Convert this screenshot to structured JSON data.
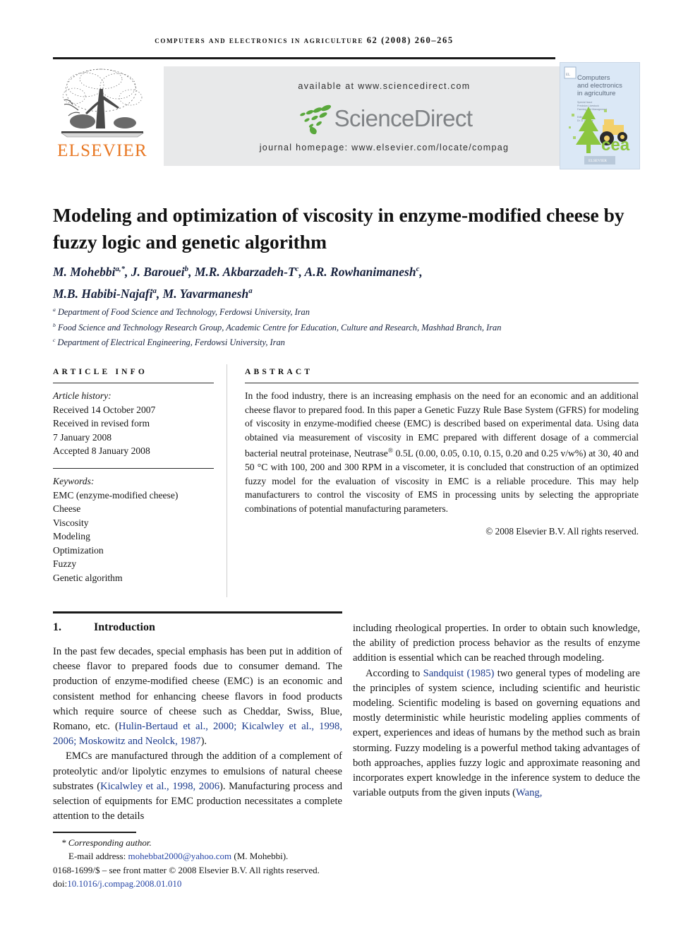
{
  "running_head": "COMPUTERS AND ELECTRONICS IN AGRICULTURE 62 (2008) 260–265",
  "masthead": {
    "publisher_name": "ELSEVIER",
    "publisher_logo_alt": "elsevier-tree-logo",
    "available_at": "available at www.sciencedirect.com",
    "sciencedirect_wordmark": "ScienceDirect",
    "journal_homepage": "journal homepage: www.elsevier.com/locate/compag",
    "cover": {
      "title_line1": "Computers",
      "title_line2": "and electronics",
      "title_line3": "in agriculture",
      "sub_line1": "Special Issue",
      "sub_line2": "Precision Livestock",
      "sub_line3": "Farming and Management",
      "editor_label": "Editor",
      "editor_name": "Dr. D. Goense",
      "acronym": "cea",
      "footer": "ELSEVIER"
    }
  },
  "article": {
    "title": "Modeling and optimization of viscosity in enzyme-modified cheese by fuzzy logic and genetic algorithm",
    "authors": [
      {
        "name": "M. Mohebbi",
        "sup": "a,*"
      },
      {
        "name": "J. Barouei",
        "sup": "b"
      },
      {
        "name": "M.R. Akbarzadeh-T",
        "sup": "c"
      },
      {
        "name": "A.R. Rowhanimanesh",
        "sup": "c"
      },
      {
        "name": "M.B. Habibi-Najafi",
        "sup": "a"
      },
      {
        "name": "M. Yavarmanesh",
        "sup": "a"
      }
    ],
    "affiliations": [
      {
        "label": "a",
        "text": "Department of Food Science and Technology, Ferdowsi University, Iran"
      },
      {
        "label": "b",
        "text": "Food Science and Technology Research Group, Academic Centre for Education, Culture and Research, Mashhad Branch, Iran"
      },
      {
        "label": "c",
        "text": "Department of Electrical Engineering, Ferdowsi University, Iran"
      }
    ]
  },
  "info": {
    "label": "ARTICLE INFO",
    "history_title": "Article history:",
    "history_lines": [
      "Received 14 October 2007",
      "Received in revised form",
      "7 January 2008",
      "Accepted 8 January 2008"
    ],
    "keywords_title": "Keywords:",
    "keywords": [
      "EMC (enzyme-modified cheese)",
      "Cheese",
      "Viscosity",
      "Modeling",
      "Optimization",
      "Fuzzy",
      "Genetic algorithm"
    ]
  },
  "abstract": {
    "label": "ABSTRACT",
    "text_part1": "In the food industry, there is an increasing emphasis on the need for an economic and an additional cheese flavor to prepared food. In this paper a Genetic Fuzzy Rule Base System (GFRS) for modeling of viscosity in enzyme-modified cheese (EMC) is described based on experimental data. Using data obtained via measurement of viscosity in EMC prepared with different dosage of a commercial bacterial neutral proteinase, Neutrase",
    "registered_mark": "®",
    "text_part2": " 0.5L (0.00, 0.05, 0.10, 0.15, 0.20 and 0.25 v/w%) at 30, 40 and 50 °C with 100, 200 and 300 RPM in a viscometer, it is concluded that construction of an optimized fuzzy model for the evaluation of viscosity in EMC is a reliable procedure. This may help manufacturers to control the viscosity of EMS in processing units by selecting the appropriate combinations of potential manufacturing parameters.",
    "copyright": "© 2008 Elsevier B.V. All rights reserved."
  },
  "introduction": {
    "number": "1.",
    "heading": "Introduction",
    "left_p1_a": "In the past few decades, special emphasis has been put in addition of cheese flavor to prepared foods due to consumer demand. The production of enzyme-modified cheese (EMC) is an economic and consistent method for enhancing cheese flavors in food products which require source of cheese such as Cheddar, Swiss, Blue, Romano, etc. (",
    "left_p1_ref": "Hulin-Bertaud et al., 2000; Kicalwley et al., 1998, 2006; Moskowitz and Neolck, 1987",
    "left_p1_b": ").",
    "left_p2_a": "EMCs are manufactured through the addition of a complement of proteolytic and/or lipolytic enzymes to emulsions of natural cheese substrates (",
    "left_p2_ref": "Kicalwley et al., 1998, 2006",
    "left_p2_b": "). Manufacturing process and selection of equipments for EMC production necessitates a complete attention to the details",
    "right_p1": "including rheological properties. In order to obtain such knowledge, the ability of prediction process behavior as the results of enzyme addition is essential which can be reached through modeling.",
    "right_p2_a": "According to ",
    "right_p2_ref": "Sandquist (1985)",
    "right_p2_b": " two general types of modeling are the principles of system science, including scientific and heuristic modeling. Scientific modeling is based on governing equations and mostly deterministic while heuristic modeling applies comments of expert, experiences and ideas of humans by the method such as brain storming. Fuzzy modeling is a powerful method taking advantages of both approaches, applies fuzzy logic and approximate reasoning and incorporates expert knowledge in the inference system to deduce the variable outputs from the given inputs (",
    "right_p2_ref2": "Wang,"
  },
  "footnote": {
    "corresponding": "* Corresponding author.",
    "email_label": "E-mail address: ",
    "email": "mohebbat2000@yahoo.com",
    "email_suffix": " (M. Mohebbi).",
    "imprint": "0168-1699/$ – see front matter © 2008 Elsevier B.V. All rights reserved.",
    "doi_label": "doi:",
    "doi": "10.1016/j.compag.2008.01.010"
  },
  "colors": {
    "elsevier_orange": "#e87722",
    "sciencedirect_grey": "#7f8285",
    "sciencedirect_green": "#5aa83c",
    "reference_blue": "#1b3a8c",
    "link_blue": "#2746a6",
    "banner_grey": "#e8e9ea",
    "cover_blue": "#dce9f7"
  }
}
